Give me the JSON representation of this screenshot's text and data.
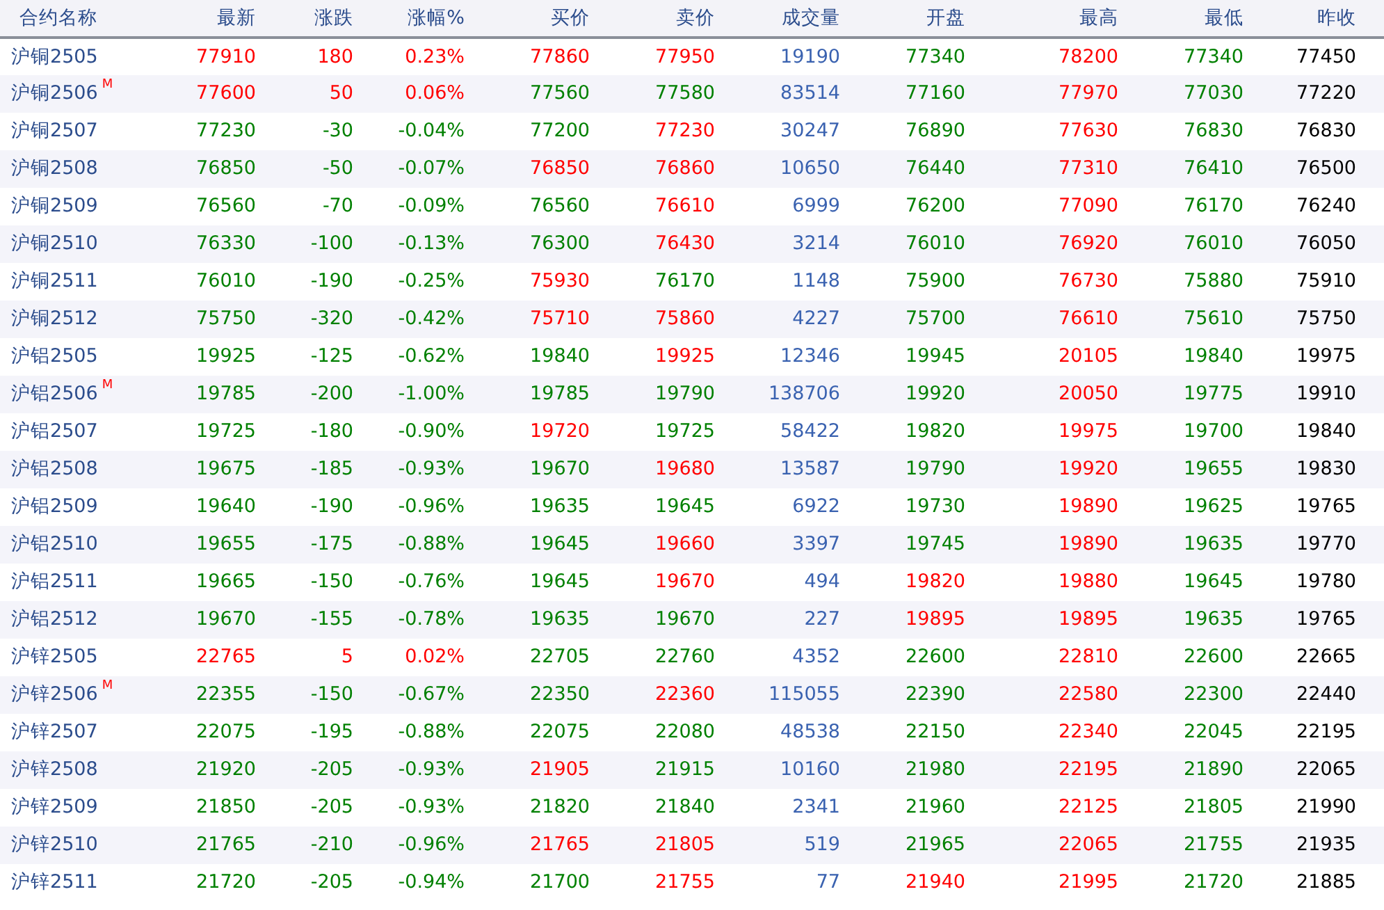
{
  "columns": [
    "合约名称",
    "最新",
    "涨跌",
    "涨幅%",
    "买价",
    "卖价",
    "成交量",
    "开盘",
    "最高",
    "最低",
    "昨收"
  ],
  "rows": [
    {
      "name": "沪铜2505",
      "cells": [
        {
          "text": "77910",
          "color": "#ff0000"
        },
        {
          "text": "180",
          "color": "#ff0000"
        },
        {
          "text": "0.23%",
          "color": "#ff0000"
        },
        {
          "text": "77860",
          "color": "#ff0000"
        },
        {
          "text": "77950",
          "color": "#ff0000"
        },
        {
          "text": "19190",
          "color": "#3a62b0"
        },
        {
          "text": "77340",
          "color": "#008000"
        },
        {
          "text": "78200",
          "color": "#ff0000"
        },
        {
          "text": "77340",
          "color": "#008000"
        },
        {
          "text": "77450",
          "color": "#000000"
        }
      ]
    },
    {
      "name": "沪铜2506",
      "badge": "M",
      "cells": [
        {
          "text": "77600",
          "color": "#ff0000"
        },
        {
          "text": "50",
          "color": "#ff0000"
        },
        {
          "text": "0.06%",
          "color": "#ff0000"
        },
        {
          "text": "77560",
          "color": "#008000"
        },
        {
          "text": "77580",
          "color": "#008000"
        },
        {
          "text": "83514",
          "color": "#3a62b0"
        },
        {
          "text": "77160",
          "color": "#008000"
        },
        {
          "text": "77970",
          "color": "#ff0000"
        },
        {
          "text": "77030",
          "color": "#008000"
        },
        {
          "text": "77220",
          "color": "#000000"
        }
      ]
    },
    {
      "name": "沪铜2507",
      "cells": [
        {
          "text": "77230",
          "color": "#008000"
        },
        {
          "text": "-30",
          "color": "#008000"
        },
        {
          "text": "-0.04%",
          "color": "#008000"
        },
        {
          "text": "77200",
          "color": "#008000"
        },
        {
          "text": "77230",
          "color": "#ff0000"
        },
        {
          "text": "30247",
          "color": "#3a62b0"
        },
        {
          "text": "76890",
          "color": "#008000"
        },
        {
          "text": "77630",
          "color": "#ff0000"
        },
        {
          "text": "76830",
          "color": "#008000"
        },
        {
          "text": "76830",
          "color": "#000000"
        }
      ]
    },
    {
      "name": "沪铜2508",
      "cells": [
        {
          "text": "76850",
          "color": "#008000"
        },
        {
          "text": "-50",
          "color": "#008000"
        },
        {
          "text": "-0.07%",
          "color": "#008000"
        },
        {
          "text": "76850",
          "color": "#ff0000"
        },
        {
          "text": "76860",
          "color": "#ff0000"
        },
        {
          "text": "10650",
          "color": "#3a62b0"
        },
        {
          "text": "76440",
          "color": "#008000"
        },
        {
          "text": "77310",
          "color": "#ff0000"
        },
        {
          "text": "76410",
          "color": "#008000"
        },
        {
          "text": "76500",
          "color": "#000000"
        }
      ]
    },
    {
      "name": "沪铜2509",
      "cells": [
        {
          "text": "76560",
          "color": "#008000"
        },
        {
          "text": "-70",
          "color": "#008000"
        },
        {
          "text": "-0.09%",
          "color": "#008000"
        },
        {
          "text": "76560",
          "color": "#008000"
        },
        {
          "text": "76610",
          "color": "#ff0000"
        },
        {
          "text": "6999",
          "color": "#3a62b0"
        },
        {
          "text": "76200",
          "color": "#008000"
        },
        {
          "text": "77090",
          "color": "#ff0000"
        },
        {
          "text": "76170",
          "color": "#008000"
        },
        {
          "text": "76240",
          "color": "#000000"
        }
      ]
    },
    {
      "name": "沪铜2510",
      "cells": [
        {
          "text": "76330",
          "color": "#008000"
        },
        {
          "text": "-100",
          "color": "#008000"
        },
        {
          "text": "-0.13%",
          "color": "#008000"
        },
        {
          "text": "76300",
          "color": "#008000"
        },
        {
          "text": "76430",
          "color": "#ff0000"
        },
        {
          "text": "3214",
          "color": "#3a62b0"
        },
        {
          "text": "76010",
          "color": "#008000"
        },
        {
          "text": "76920",
          "color": "#ff0000"
        },
        {
          "text": "76010",
          "color": "#008000"
        },
        {
          "text": "76050",
          "color": "#000000"
        }
      ]
    },
    {
      "name": "沪铜2511",
      "cells": [
        {
          "text": "76010",
          "color": "#008000"
        },
        {
          "text": "-190",
          "color": "#008000"
        },
        {
          "text": "-0.25%",
          "color": "#008000"
        },
        {
          "text": "75930",
          "color": "#ff0000"
        },
        {
          "text": "76170",
          "color": "#008000"
        },
        {
          "text": "1148",
          "color": "#3a62b0"
        },
        {
          "text": "75900",
          "color": "#008000"
        },
        {
          "text": "76730",
          "color": "#ff0000"
        },
        {
          "text": "75880",
          "color": "#008000"
        },
        {
          "text": "75910",
          "color": "#000000"
        }
      ]
    },
    {
      "name": "沪铜2512",
      "cells": [
        {
          "text": "75750",
          "color": "#008000"
        },
        {
          "text": "-320",
          "color": "#008000"
        },
        {
          "text": "-0.42%",
          "color": "#008000"
        },
        {
          "text": "75710",
          "color": "#ff0000"
        },
        {
          "text": "75860",
          "color": "#ff0000"
        },
        {
          "text": "4227",
          "color": "#3a62b0"
        },
        {
          "text": "75700",
          "color": "#008000"
        },
        {
          "text": "76610",
          "color": "#ff0000"
        },
        {
          "text": "75610",
          "color": "#008000"
        },
        {
          "text": "75750",
          "color": "#000000"
        }
      ]
    },
    {
      "name": "沪铝2505",
      "cells": [
        {
          "text": "19925",
          "color": "#008000"
        },
        {
          "text": "-125",
          "color": "#008000"
        },
        {
          "text": "-0.62%",
          "color": "#008000"
        },
        {
          "text": "19840",
          "color": "#008000"
        },
        {
          "text": "19925",
          "color": "#ff0000"
        },
        {
          "text": "12346",
          "color": "#3a62b0"
        },
        {
          "text": "19945",
          "color": "#008000"
        },
        {
          "text": "20105",
          "color": "#ff0000"
        },
        {
          "text": "19840",
          "color": "#008000"
        },
        {
          "text": "19975",
          "color": "#000000"
        }
      ]
    },
    {
      "name": "沪铝2506",
      "badge": "M",
      "cells": [
        {
          "text": "19785",
          "color": "#008000"
        },
        {
          "text": "-200",
          "color": "#008000"
        },
        {
          "text": "-1.00%",
          "color": "#008000"
        },
        {
          "text": "19785",
          "color": "#008000"
        },
        {
          "text": "19790",
          "color": "#008000"
        },
        {
          "text": "138706",
          "color": "#3a62b0"
        },
        {
          "text": "19920",
          "color": "#008000"
        },
        {
          "text": "20050",
          "color": "#ff0000"
        },
        {
          "text": "19775",
          "color": "#008000"
        },
        {
          "text": "19910",
          "color": "#000000"
        }
      ]
    },
    {
      "name": "沪铝2507",
      "cells": [
        {
          "text": "19725",
          "color": "#008000"
        },
        {
          "text": "-180",
          "color": "#008000"
        },
        {
          "text": "-0.90%",
          "color": "#008000"
        },
        {
          "text": "19720",
          "color": "#ff0000"
        },
        {
          "text": "19725",
          "color": "#008000"
        },
        {
          "text": "58422",
          "color": "#3a62b0"
        },
        {
          "text": "19820",
          "color": "#008000"
        },
        {
          "text": "19975",
          "color": "#ff0000"
        },
        {
          "text": "19700",
          "color": "#008000"
        },
        {
          "text": "19840",
          "color": "#000000"
        }
      ]
    },
    {
      "name": "沪铝2508",
      "cells": [
        {
          "text": "19675",
          "color": "#008000"
        },
        {
          "text": "-185",
          "color": "#008000"
        },
        {
          "text": "-0.93%",
          "color": "#008000"
        },
        {
          "text": "19670",
          "color": "#008000"
        },
        {
          "text": "19680",
          "color": "#ff0000"
        },
        {
          "text": "13587",
          "color": "#3a62b0"
        },
        {
          "text": "19790",
          "color": "#008000"
        },
        {
          "text": "19920",
          "color": "#ff0000"
        },
        {
          "text": "19655",
          "color": "#008000"
        },
        {
          "text": "19830",
          "color": "#000000"
        }
      ]
    },
    {
      "name": "沪铝2509",
      "cells": [
        {
          "text": "19640",
          "color": "#008000"
        },
        {
          "text": "-190",
          "color": "#008000"
        },
        {
          "text": "-0.96%",
          "color": "#008000"
        },
        {
          "text": "19635",
          "color": "#008000"
        },
        {
          "text": "19645",
          "color": "#008000"
        },
        {
          "text": "6922",
          "color": "#3a62b0"
        },
        {
          "text": "19730",
          "color": "#008000"
        },
        {
          "text": "19890",
          "color": "#ff0000"
        },
        {
          "text": "19625",
          "color": "#008000"
        },
        {
          "text": "19765",
          "color": "#000000"
        }
      ]
    },
    {
      "name": "沪铝2510",
      "cells": [
        {
          "text": "19655",
          "color": "#008000"
        },
        {
          "text": "-175",
          "color": "#008000"
        },
        {
          "text": "-0.88%",
          "color": "#008000"
        },
        {
          "text": "19645",
          "color": "#008000"
        },
        {
          "text": "19660",
          "color": "#ff0000"
        },
        {
          "text": "3397",
          "color": "#3a62b0"
        },
        {
          "text": "19745",
          "color": "#008000"
        },
        {
          "text": "19890",
          "color": "#ff0000"
        },
        {
          "text": "19635",
          "color": "#008000"
        },
        {
          "text": "19770",
          "color": "#000000"
        }
      ]
    },
    {
      "name": "沪铝2511",
      "cells": [
        {
          "text": "19665",
          "color": "#008000"
        },
        {
          "text": "-150",
          "color": "#008000"
        },
        {
          "text": "-0.76%",
          "color": "#008000"
        },
        {
          "text": "19645",
          "color": "#008000"
        },
        {
          "text": "19670",
          "color": "#ff0000"
        },
        {
          "text": "494",
          "color": "#3a62b0"
        },
        {
          "text": "19820",
          "color": "#ff0000"
        },
        {
          "text": "19880",
          "color": "#ff0000"
        },
        {
          "text": "19645",
          "color": "#008000"
        },
        {
          "text": "19780",
          "color": "#000000"
        }
      ]
    },
    {
      "name": "沪铝2512",
      "cells": [
        {
          "text": "19670",
          "color": "#008000"
        },
        {
          "text": "-155",
          "color": "#008000"
        },
        {
          "text": "-0.78%",
          "color": "#008000"
        },
        {
          "text": "19635",
          "color": "#008000"
        },
        {
          "text": "19670",
          "color": "#008000"
        },
        {
          "text": "227",
          "color": "#3a62b0"
        },
        {
          "text": "19895",
          "color": "#ff0000"
        },
        {
          "text": "19895",
          "color": "#ff0000"
        },
        {
          "text": "19635",
          "color": "#008000"
        },
        {
          "text": "19765",
          "color": "#000000"
        }
      ]
    },
    {
      "name": "沪锌2505",
      "cells": [
        {
          "text": "22765",
          "color": "#ff0000"
        },
        {
          "text": "5",
          "color": "#ff0000"
        },
        {
          "text": "0.02%",
          "color": "#ff0000"
        },
        {
          "text": "22705",
          "color": "#008000"
        },
        {
          "text": "22760",
          "color": "#008000"
        },
        {
          "text": "4352",
          "color": "#3a62b0"
        },
        {
          "text": "22600",
          "color": "#008000"
        },
        {
          "text": "22810",
          "color": "#ff0000"
        },
        {
          "text": "22600",
          "color": "#008000"
        },
        {
          "text": "22665",
          "color": "#000000"
        }
      ]
    },
    {
      "name": "沪锌2506",
      "badge": "M",
      "cells": [
        {
          "text": "22355",
          "color": "#008000"
        },
        {
          "text": "-150",
          "color": "#008000"
        },
        {
          "text": "-0.67%",
          "color": "#008000"
        },
        {
          "text": "22350",
          "color": "#008000"
        },
        {
          "text": "22360",
          "color": "#ff0000"
        },
        {
          "text": "115055",
          "color": "#3a62b0"
        },
        {
          "text": "22390",
          "color": "#008000"
        },
        {
          "text": "22580",
          "color": "#ff0000"
        },
        {
          "text": "22300",
          "color": "#008000"
        },
        {
          "text": "22440",
          "color": "#000000"
        }
      ]
    },
    {
      "name": "沪锌2507",
      "cells": [
        {
          "text": "22075",
          "color": "#008000"
        },
        {
          "text": "-195",
          "color": "#008000"
        },
        {
          "text": "-0.88%",
          "color": "#008000"
        },
        {
          "text": "22075",
          "color": "#008000"
        },
        {
          "text": "22080",
          "color": "#008000"
        },
        {
          "text": "48538",
          "color": "#3a62b0"
        },
        {
          "text": "22150",
          "color": "#008000"
        },
        {
          "text": "22340",
          "color": "#ff0000"
        },
        {
          "text": "22045",
          "color": "#008000"
        },
        {
          "text": "22195",
          "color": "#000000"
        }
      ]
    },
    {
      "name": "沪锌2508",
      "cells": [
        {
          "text": "21920",
          "color": "#008000"
        },
        {
          "text": "-205",
          "color": "#008000"
        },
        {
          "text": "-0.93%",
          "color": "#008000"
        },
        {
          "text": "21905",
          "color": "#ff0000"
        },
        {
          "text": "21915",
          "color": "#008000"
        },
        {
          "text": "10160",
          "color": "#3a62b0"
        },
        {
          "text": "21980",
          "color": "#008000"
        },
        {
          "text": "22195",
          "color": "#ff0000"
        },
        {
          "text": "21890",
          "color": "#008000"
        },
        {
          "text": "22065",
          "color": "#000000"
        }
      ]
    },
    {
      "name": "沪锌2509",
      "cells": [
        {
          "text": "21850",
          "color": "#008000"
        },
        {
          "text": "-205",
          "color": "#008000"
        },
        {
          "text": "-0.93%",
          "color": "#008000"
        },
        {
          "text": "21820",
          "color": "#008000"
        },
        {
          "text": "21840",
          "color": "#008000"
        },
        {
          "text": "2341",
          "color": "#3a62b0"
        },
        {
          "text": "21960",
          "color": "#008000"
        },
        {
          "text": "22125",
          "color": "#ff0000"
        },
        {
          "text": "21805",
          "color": "#008000"
        },
        {
          "text": "21990",
          "color": "#000000"
        }
      ]
    },
    {
      "name": "沪锌2510",
      "cells": [
        {
          "text": "21765",
          "color": "#008000"
        },
        {
          "text": "-210",
          "color": "#008000"
        },
        {
          "text": "-0.96%",
          "color": "#008000"
        },
        {
          "text": "21765",
          "color": "#ff0000"
        },
        {
          "text": "21805",
          "color": "#ff0000"
        },
        {
          "text": "519",
          "color": "#3a62b0"
        },
        {
          "text": "21965",
          "color": "#008000"
        },
        {
          "text": "22065",
          "color": "#ff0000"
        },
        {
          "text": "21755",
          "color": "#008000"
        },
        {
          "text": "21935",
          "color": "#000000"
        }
      ]
    },
    {
      "name": "沪锌2511",
      "cells": [
        {
          "text": "21720",
          "color": "#008000"
        },
        {
          "text": "-205",
          "color": "#008000"
        },
        {
          "text": "-0.94%",
          "color": "#008000"
        },
        {
          "text": "21700",
          "color": "#008000"
        },
        {
          "text": "21755",
          "color": "#ff0000"
        },
        {
          "text": "77",
          "color": "#3a62b0"
        },
        {
          "text": "21940",
          "color": "#ff0000"
        },
        {
          "text": "21995",
          "color": "#ff0000"
        },
        {
          "text": "21720",
          "color": "#008000"
        },
        {
          "text": "21885",
          "color": "#000000"
        }
      ]
    }
  ]
}
